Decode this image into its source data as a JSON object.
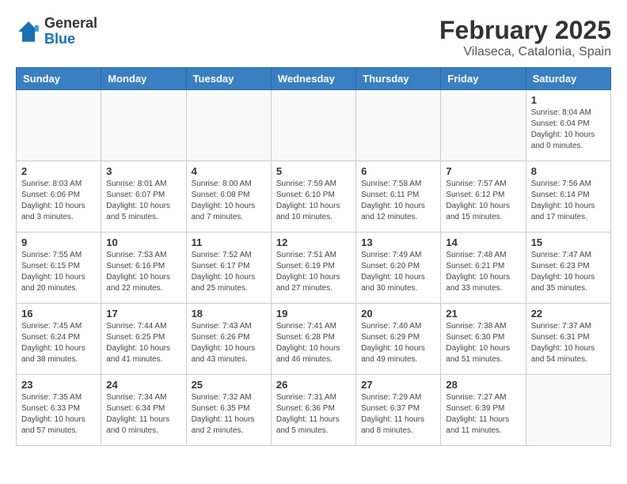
{
  "header": {
    "logo_general": "General",
    "logo_blue": "Blue",
    "month_title": "February 2025",
    "location": "Vilaseca, Catalonia, Spain"
  },
  "weekdays": [
    "Sunday",
    "Monday",
    "Tuesday",
    "Wednesday",
    "Thursday",
    "Friday",
    "Saturday"
  ],
  "weeks": [
    [
      {
        "day": "",
        "info": ""
      },
      {
        "day": "",
        "info": ""
      },
      {
        "day": "",
        "info": ""
      },
      {
        "day": "",
        "info": ""
      },
      {
        "day": "",
        "info": ""
      },
      {
        "day": "",
        "info": ""
      },
      {
        "day": "1",
        "info": "Sunrise: 8:04 AM\nSunset: 6:04 PM\nDaylight: 10 hours\nand 0 minutes."
      }
    ],
    [
      {
        "day": "2",
        "info": "Sunrise: 8:03 AM\nSunset: 6:06 PM\nDaylight: 10 hours\nand 3 minutes."
      },
      {
        "day": "3",
        "info": "Sunrise: 8:01 AM\nSunset: 6:07 PM\nDaylight: 10 hours\nand 5 minutes."
      },
      {
        "day": "4",
        "info": "Sunrise: 8:00 AM\nSunset: 6:08 PM\nDaylight: 10 hours\nand 7 minutes."
      },
      {
        "day": "5",
        "info": "Sunrise: 7:59 AM\nSunset: 6:10 PM\nDaylight: 10 hours\nand 10 minutes."
      },
      {
        "day": "6",
        "info": "Sunrise: 7:58 AM\nSunset: 6:11 PM\nDaylight: 10 hours\nand 12 minutes."
      },
      {
        "day": "7",
        "info": "Sunrise: 7:57 AM\nSunset: 6:12 PM\nDaylight: 10 hours\nand 15 minutes."
      },
      {
        "day": "8",
        "info": "Sunrise: 7:56 AM\nSunset: 6:14 PM\nDaylight: 10 hours\nand 17 minutes."
      }
    ],
    [
      {
        "day": "9",
        "info": "Sunrise: 7:55 AM\nSunset: 6:15 PM\nDaylight: 10 hours\nand 20 minutes."
      },
      {
        "day": "10",
        "info": "Sunrise: 7:53 AM\nSunset: 6:16 PM\nDaylight: 10 hours\nand 22 minutes."
      },
      {
        "day": "11",
        "info": "Sunrise: 7:52 AM\nSunset: 6:17 PM\nDaylight: 10 hours\nand 25 minutes."
      },
      {
        "day": "12",
        "info": "Sunrise: 7:51 AM\nSunset: 6:19 PM\nDaylight: 10 hours\nand 27 minutes."
      },
      {
        "day": "13",
        "info": "Sunrise: 7:49 AM\nSunset: 6:20 PM\nDaylight: 10 hours\nand 30 minutes."
      },
      {
        "day": "14",
        "info": "Sunrise: 7:48 AM\nSunset: 6:21 PM\nDaylight: 10 hours\nand 33 minutes."
      },
      {
        "day": "15",
        "info": "Sunrise: 7:47 AM\nSunset: 6:23 PM\nDaylight: 10 hours\nand 35 minutes."
      }
    ],
    [
      {
        "day": "16",
        "info": "Sunrise: 7:45 AM\nSunset: 6:24 PM\nDaylight: 10 hours\nand 38 minutes."
      },
      {
        "day": "17",
        "info": "Sunrise: 7:44 AM\nSunset: 6:25 PM\nDaylight: 10 hours\nand 41 minutes."
      },
      {
        "day": "18",
        "info": "Sunrise: 7:43 AM\nSunset: 6:26 PM\nDaylight: 10 hours\nand 43 minutes."
      },
      {
        "day": "19",
        "info": "Sunrise: 7:41 AM\nSunset: 6:28 PM\nDaylight: 10 hours\nand 46 minutes."
      },
      {
        "day": "20",
        "info": "Sunrise: 7:40 AM\nSunset: 6:29 PM\nDaylight: 10 hours\nand 49 minutes."
      },
      {
        "day": "21",
        "info": "Sunrise: 7:38 AM\nSunset: 6:30 PM\nDaylight: 10 hours\nand 51 minutes."
      },
      {
        "day": "22",
        "info": "Sunrise: 7:37 AM\nSunset: 6:31 PM\nDaylight: 10 hours\nand 54 minutes."
      }
    ],
    [
      {
        "day": "23",
        "info": "Sunrise: 7:35 AM\nSunset: 6:33 PM\nDaylight: 10 hours\nand 57 minutes."
      },
      {
        "day": "24",
        "info": "Sunrise: 7:34 AM\nSunset: 6:34 PM\nDaylight: 11 hours\nand 0 minutes."
      },
      {
        "day": "25",
        "info": "Sunrise: 7:32 AM\nSunset: 6:35 PM\nDaylight: 11 hours\nand 2 minutes."
      },
      {
        "day": "26",
        "info": "Sunrise: 7:31 AM\nSunset: 6:36 PM\nDaylight: 11 hours\nand 5 minutes."
      },
      {
        "day": "27",
        "info": "Sunrise: 7:29 AM\nSunset: 6:37 PM\nDaylight: 11 hours\nand 8 minutes."
      },
      {
        "day": "28",
        "info": "Sunrise: 7:27 AM\nSunset: 6:39 PM\nDaylight: 11 hours\nand 11 minutes."
      },
      {
        "day": "",
        "info": ""
      }
    ]
  ]
}
